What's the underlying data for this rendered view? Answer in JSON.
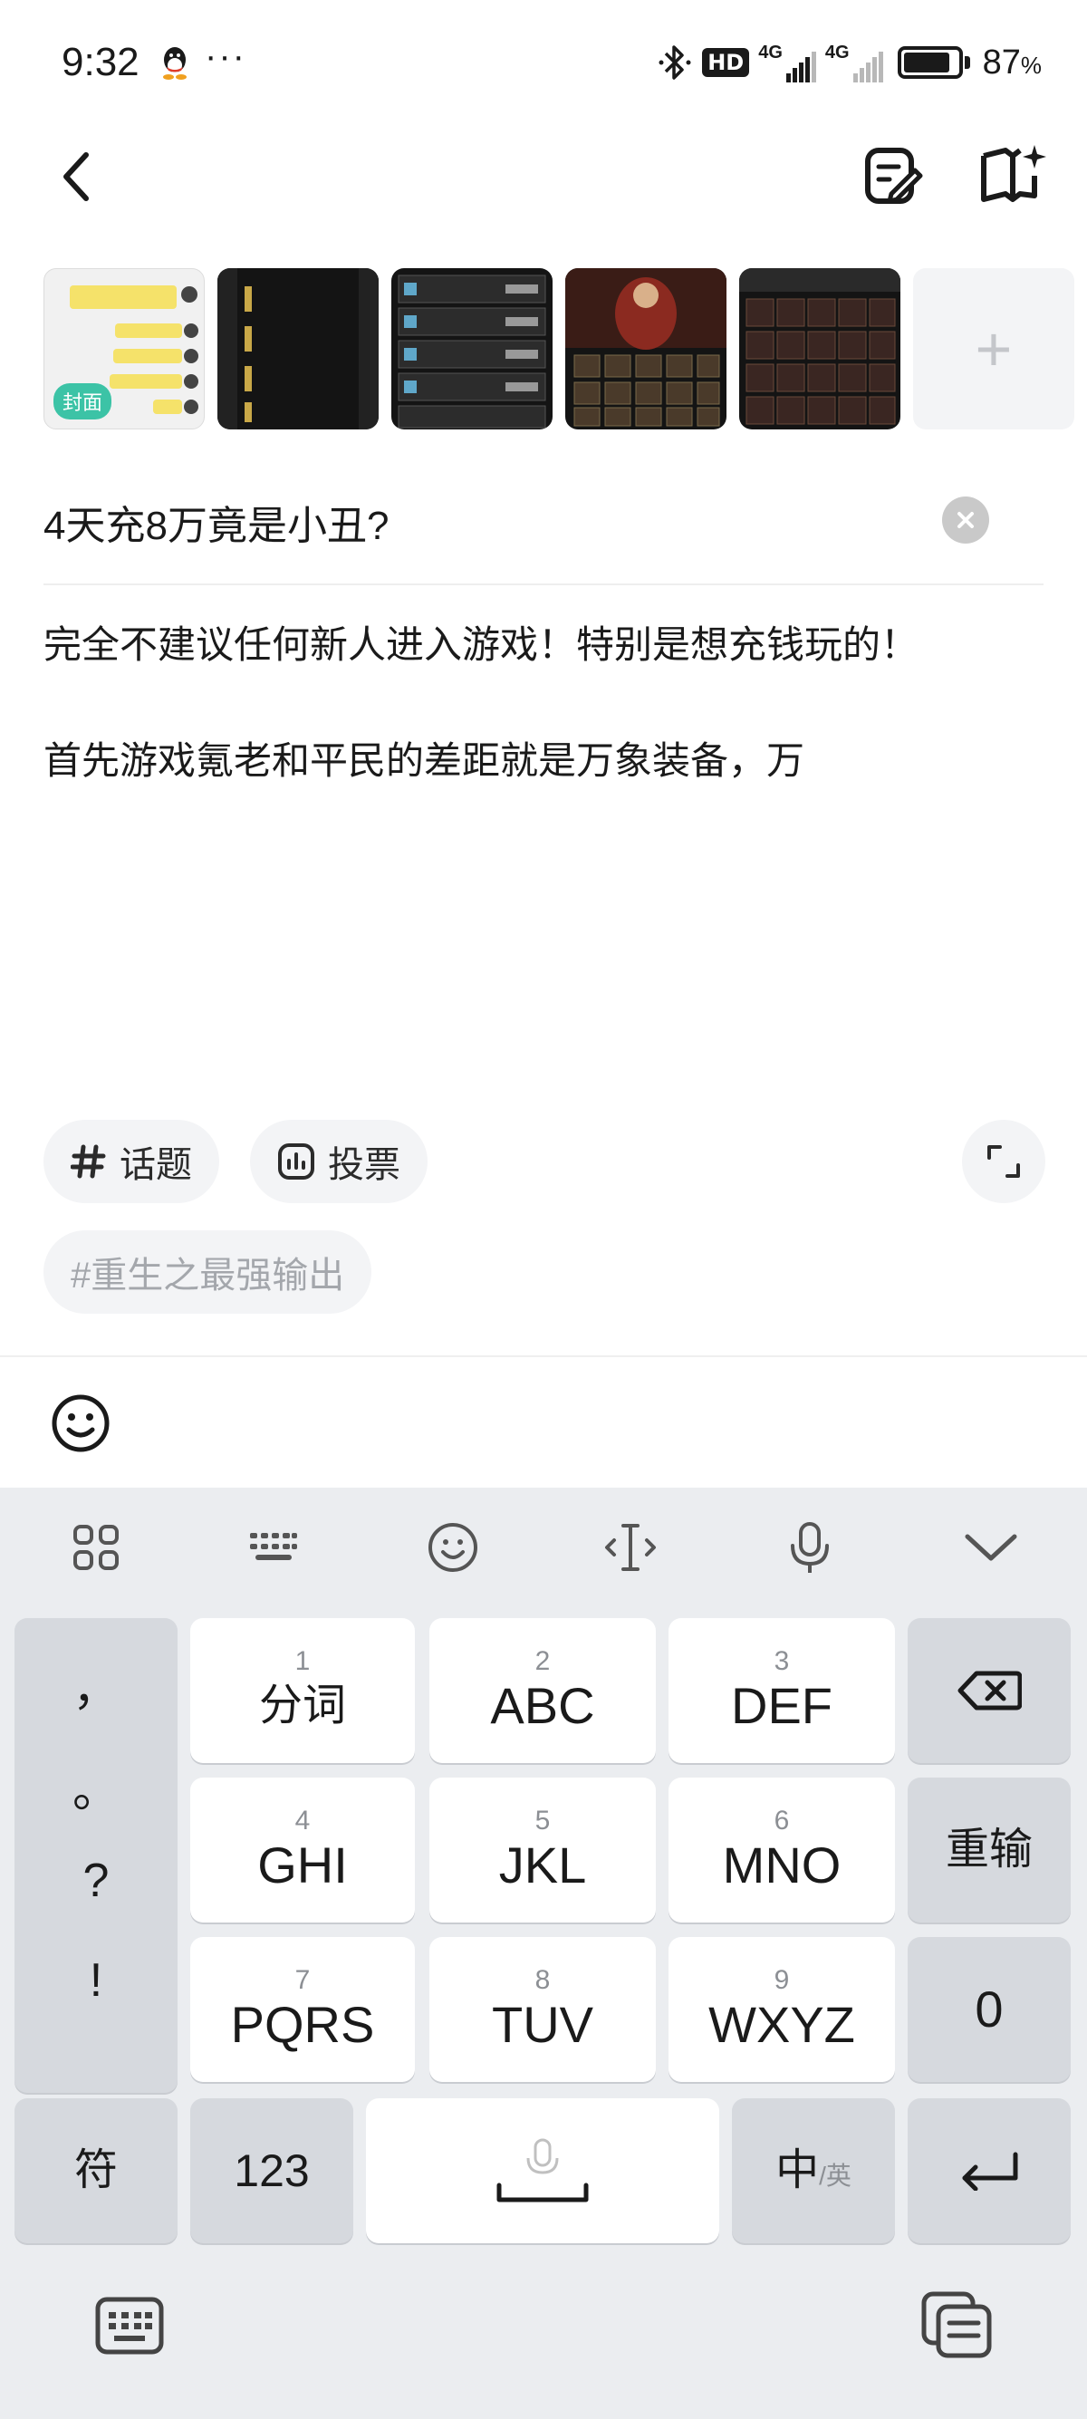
{
  "status_bar": {
    "time": "9:32",
    "dots": "···",
    "hd_badge": "HD",
    "net1": "4G",
    "net2": "4G",
    "battery_level": 0.87,
    "battery_pct": "87",
    "battery_unit": "%"
  },
  "nav": {
    "back_icon": "chevron-left-icon",
    "draft_icon": "draft-edit-icon",
    "guide_icon": "book-sparkle-icon"
  },
  "images": {
    "cover_tag": "封面",
    "add_icon": "+"
  },
  "post": {
    "title": "4天充8万竟是小丑?",
    "paragraph1": "完全不建议任何新人进入游戏！特别是想充钱玩的！",
    "paragraph2": "首先游戏氪老和平民的差距就是万象装备，万"
  },
  "chips": {
    "topic_label": "话题",
    "vote_label": "投票",
    "suggested_topic": "#重生之最强输出"
  },
  "keyboard": {
    "punct": [
      "，",
      "。",
      "?",
      "!"
    ],
    "keys": [
      {
        "num": "1",
        "label": "分词"
      },
      {
        "num": "2",
        "label": "ABC"
      },
      {
        "num": "3",
        "label": "DEF"
      },
      {
        "num": "4",
        "label": "GHI"
      },
      {
        "num": "5",
        "label": "JKL"
      },
      {
        "num": "6",
        "label": "MNO"
      },
      {
        "num": "7",
        "label": "PQRS"
      },
      {
        "num": "8",
        "label": "TUV"
      },
      {
        "num": "9",
        "label": "WXYZ"
      }
    ],
    "reset_label": "重输",
    "zero_label": "0",
    "symbol_label": "符",
    "num_label": "123",
    "lang_main": "中",
    "lang_sub": "/英"
  }
}
